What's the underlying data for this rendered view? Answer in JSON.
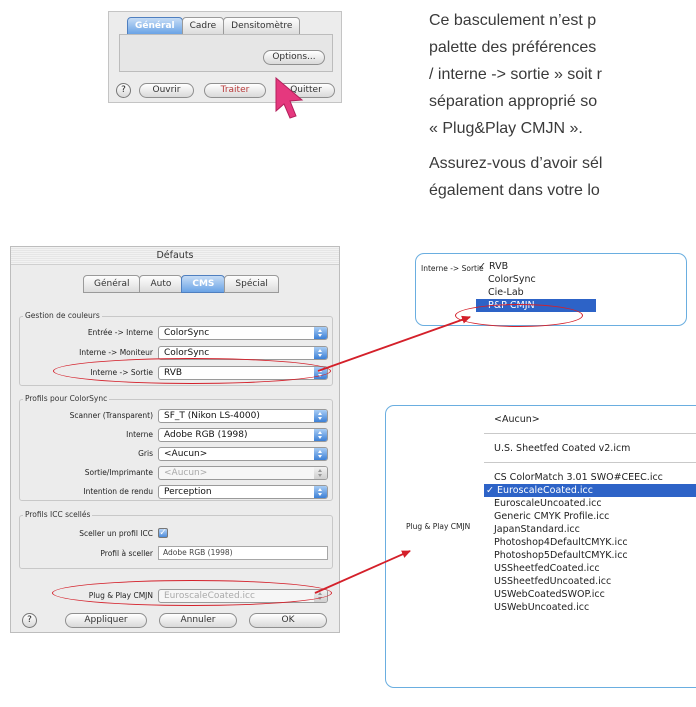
{
  "paragraph1": [
    "Ce basculement n’est p",
    "palette des préférences",
    "/ interne -> sortie » soit r",
    "séparation approprié so",
    "« Plug&Play CMJN »."
  ],
  "paragraph2": [
    "Assurez-vous d’avoir sél",
    "également dans votre lo"
  ],
  "small_dialog": {
    "tabs": [
      "Général",
      "Cadre",
      "Densitomètre"
    ],
    "active_tab": "Général",
    "options_label": "Options...",
    "help_label": "?",
    "buttons": [
      "Ouvrir",
      "Traiter",
      "Quitter"
    ]
  },
  "defaults_window": {
    "title": "Défauts",
    "tabs": [
      "Général",
      "Auto",
      "CMS",
      "Spécial"
    ],
    "active_tab": "CMS",
    "color_management": {
      "group_label": "Gestion de couleurs",
      "rows": [
        {
          "label": "Entrée -> Interne",
          "value": "ColorSync"
        },
        {
          "label": "Interne -> Moniteur",
          "value": "ColorSync"
        },
        {
          "label": "Interne -> Sortie",
          "value": "RVB"
        }
      ]
    },
    "colorsync_profiles": {
      "group_label": "Profils pour ColorSync",
      "rows": [
        {
          "label": "Scanner (Transparent)",
          "value": "SF_T (Nikon LS-4000)",
          "disabled": false
        },
        {
          "label": "Interne",
          "value": "Adobe RGB (1998)",
          "disabled": false
        },
        {
          "label": "Gris",
          "value": "<Aucun>",
          "disabled": false
        },
        {
          "label": "Sortie/Imprimante",
          "value": "<Aucun>",
          "disabled": true
        },
        {
          "label": "Intention de rendu",
          "value": "Perception",
          "disabled": false
        }
      ]
    },
    "icc_sealed": {
      "group_label": "Profils ICC scellés",
      "seal_label": "Sceller un profil ICC",
      "seal_checked": true,
      "profile_label": "Profil à sceller",
      "profile_value": "Adobe RGB (1998)"
    },
    "plug_play": {
      "label": "Plug & Play CMJN",
      "value": "EuroscaleCoated.icc"
    },
    "help_label": "?",
    "buttons": [
      "Appliquer",
      "Annuler",
      "OK"
    ]
  },
  "output_menu": {
    "label": "Interne -> Sortie",
    "checked_item": "RVB",
    "items": [
      "RVB",
      "ColorSync",
      "Cie-Lab",
      "P&P CMJN"
    ],
    "highlighted": "P&P CMJN"
  },
  "cmyk_menu": {
    "label": "Plug & Play CMJN",
    "header_items": [
      "<Aucun>",
      "U.S. Sheetfed Coated v2.icm"
    ],
    "items": [
      "CS ColorMatch 3.01 SWO#CEEC.icc",
      "EuroscaleCoated.icc",
      "EuroscaleUncoated.icc",
      "Generic CMYK Profile.icc",
      "JapanStandard.icc",
      "Photoshop4DefaultCMYK.icc",
      "Photoshop5DefaultCMYK.icc",
      "USSheetfedCoated.icc",
      "USSheetfedUncoated.icc",
      "USWebCoatedSWOP.icc",
      "USWebUncoated.icc"
    ],
    "selected": "EuroscaleCoated.icc"
  },
  "colors": {
    "accent_red": "#d4202a",
    "selection_blue": "#2d63c7",
    "panel_border": "#6aaee0"
  }
}
